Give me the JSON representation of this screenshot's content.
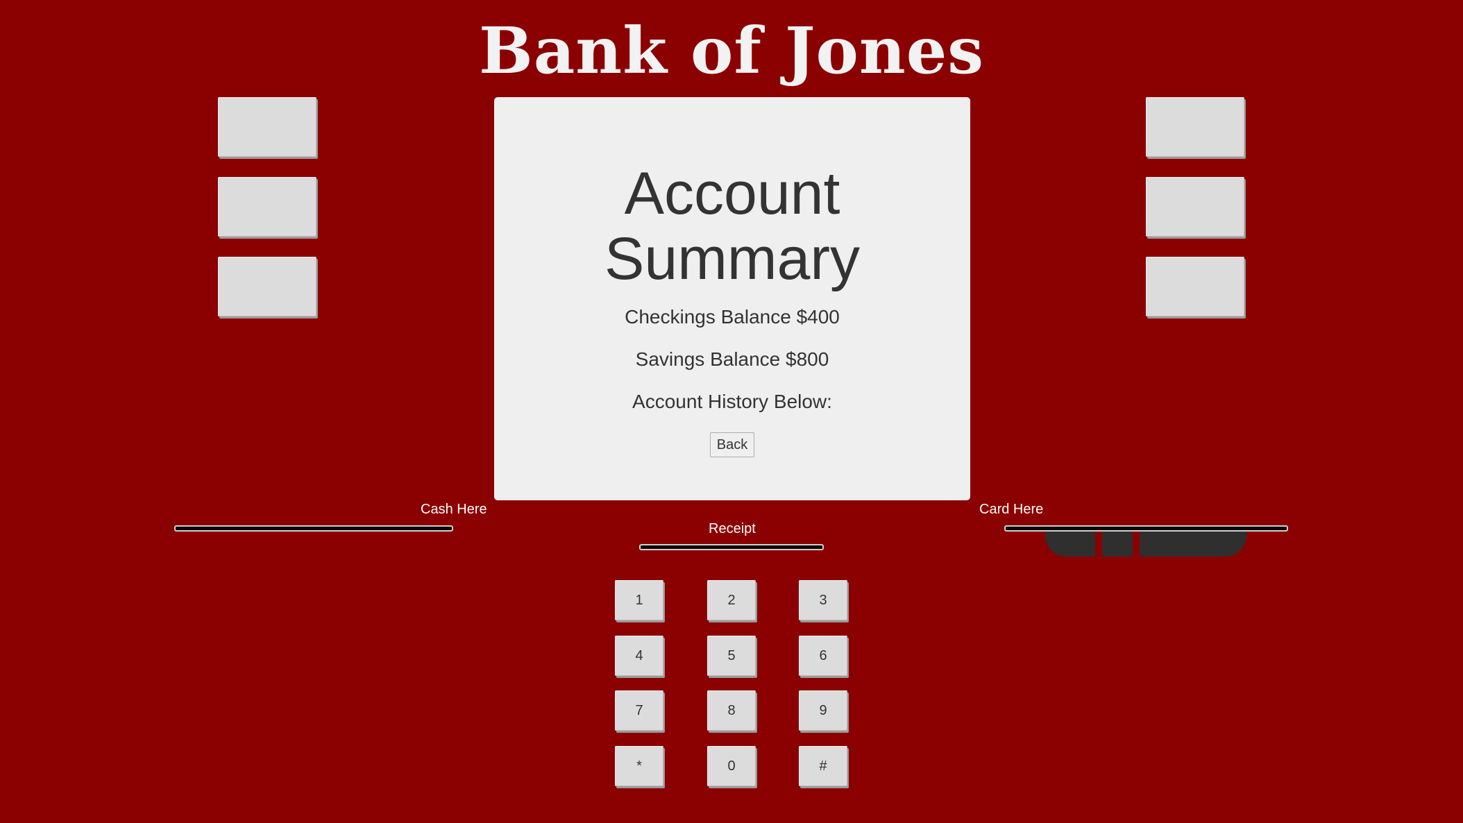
{
  "header": {
    "bank_name": "Bank of Jones"
  },
  "screen": {
    "title": "Account Summary",
    "checking_text": "Checkings Balance $400",
    "savings_text": "Savings Balance $800",
    "history_text": "Account History Below:",
    "back_label": "Back"
  },
  "slots": {
    "cash_label": "Cash Here",
    "receipt_label": "Receipt",
    "card_label": "Card Here"
  },
  "keypad": {
    "keys": [
      "1",
      "2",
      "3",
      "4",
      "5",
      "6",
      "7",
      "8",
      "9",
      "*",
      "0",
      "#"
    ]
  },
  "colors": {
    "background": "#8b0000",
    "screen": "#efefef",
    "button": "#dcdcdc",
    "text": "#333333"
  }
}
